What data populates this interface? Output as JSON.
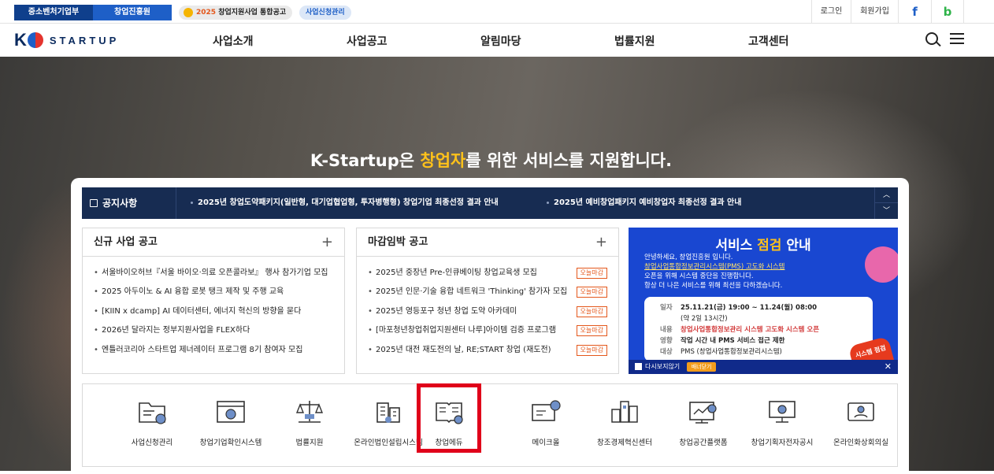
{
  "topbar": {
    "mss": "중소벤처기업부",
    "kised": "창업진흥원",
    "notice_year": "2025",
    "notice_text": "창업지원사업 통합공고",
    "apply": "사업신청관리",
    "login": "로그인",
    "join": "회원가입",
    "facebook": "f",
    "blog": "b"
  },
  "nav": {
    "logo_k": "K",
    "logo_text": "STARTUP",
    "menu": [
      "사업소개",
      "사업공고",
      "알림마당",
      "법률지원",
      "고객센터"
    ]
  },
  "hero": {
    "title_pre": "K-Startup은 ",
    "title_hl": "창업자",
    "title_post": "를 위한 서비스를 지원합니다."
  },
  "notice": {
    "label": "공지사항",
    "items": [
      "2025년 창업도약패키지(일반형, 대기업협업형, 투자병행형) 창업기업 최종선정 결과 안내",
      "2025년 예비창업패키지 예비창업자 최종선정 결과 안내"
    ],
    "up": "︿",
    "down": "﹀"
  },
  "new_box": {
    "title": "신규 사업 공고",
    "plus": "+",
    "items": [
      "서울바이오허브『서울 바이오·의료 오픈콜라보』 행사 참가기업 모집",
      "2025 아두이노 & AI 융합 로봇 탱크 제작 및 주행 교육",
      "[KIIN x dcamp] AI 데이터센터, 에너지 혁신의 방향을 묻다",
      "2026년 달라지는 정부지원사업을 FLEX하다",
      "엔틀러코리아 스타트업 제너레이터 프로그램 8기 참여자 모집"
    ]
  },
  "deadline_box": {
    "title": "마감임박 공고",
    "plus": "+",
    "tag": "오늘마감",
    "items": [
      "2025년 중장년 Pre-인큐베이팅 창업교육생 모집",
      "2025년 인문·기술 융합 네트워크 'Thinking' 참가자 모집",
      "2025년 영등포구 청년 창업 도약 아카데미",
      "[마포청년창업취업지원센터 나루]아이템 검증 프로그램",
      "2025년 대전 재도전의 날, RE;START 창업 (재도전)"
    ]
  },
  "banner": {
    "title_a": "서비스 ",
    "title_hl": "점검",
    "title_b": " 안내",
    "intro1": "안녕하세요, 창업진흥원 입니다.",
    "intro2": "창업사업통합정보관리시스템(PMS) 고도화 시스템",
    "intro3": "오픈을 위해 시스템 중단을 진행합니다.",
    "intro4": "항상 더 나은 서비스를 위해 최선을 다하겠습니다.",
    "date_k": "일자",
    "date_v": "25.11.21(금) 19:00 ~ 11.24(월) 08:00",
    "date_sub": "(약 2일 13시간)",
    "content_k": "내용",
    "content_v": "창업사업통합정보관리 시스템 고도화 시스템 오픈",
    "effect_k": "영향",
    "effect_v": "작업 시간 내 PMS 서비스 접근 제한",
    "target_k": "대상",
    "target_v": "PMS (창업사업통합정보관리시스템)",
    "stamp": "시스템 점검",
    "no_show": "다시보지않기",
    "close": "배너닫기",
    "x": "✕"
  },
  "quick": [
    {
      "label": "사업신청관리",
      "icon": "folder-edit-icon"
    },
    {
      "label": "창업기업확인시스템",
      "icon": "monitor-check-icon"
    },
    {
      "label": "법률지원",
      "icon": "scales-icon"
    },
    {
      "label": "온라인법인설립시스템",
      "icon": "building-icon"
    },
    {
      "label": "창업에듀",
      "icon": "book-icon"
    },
    {
      "label": "메이크올",
      "icon": "monitor-gear-icon"
    },
    {
      "label": "창조경제혁신센터",
      "icon": "city-icon"
    },
    {
      "label": "창업공간플랫폼",
      "icon": "space-chart-icon"
    },
    {
      "label": "창업기획자전자공시",
      "icon": "presentation-icon"
    },
    {
      "label": "온라인화상회의실",
      "icon": "video-meeting-icon"
    }
  ],
  "colors": {
    "navy": "#172c52",
    "accent": "#1e5fc7",
    "highlight": "#ffc21a",
    "selection": "#e0001a"
  }
}
